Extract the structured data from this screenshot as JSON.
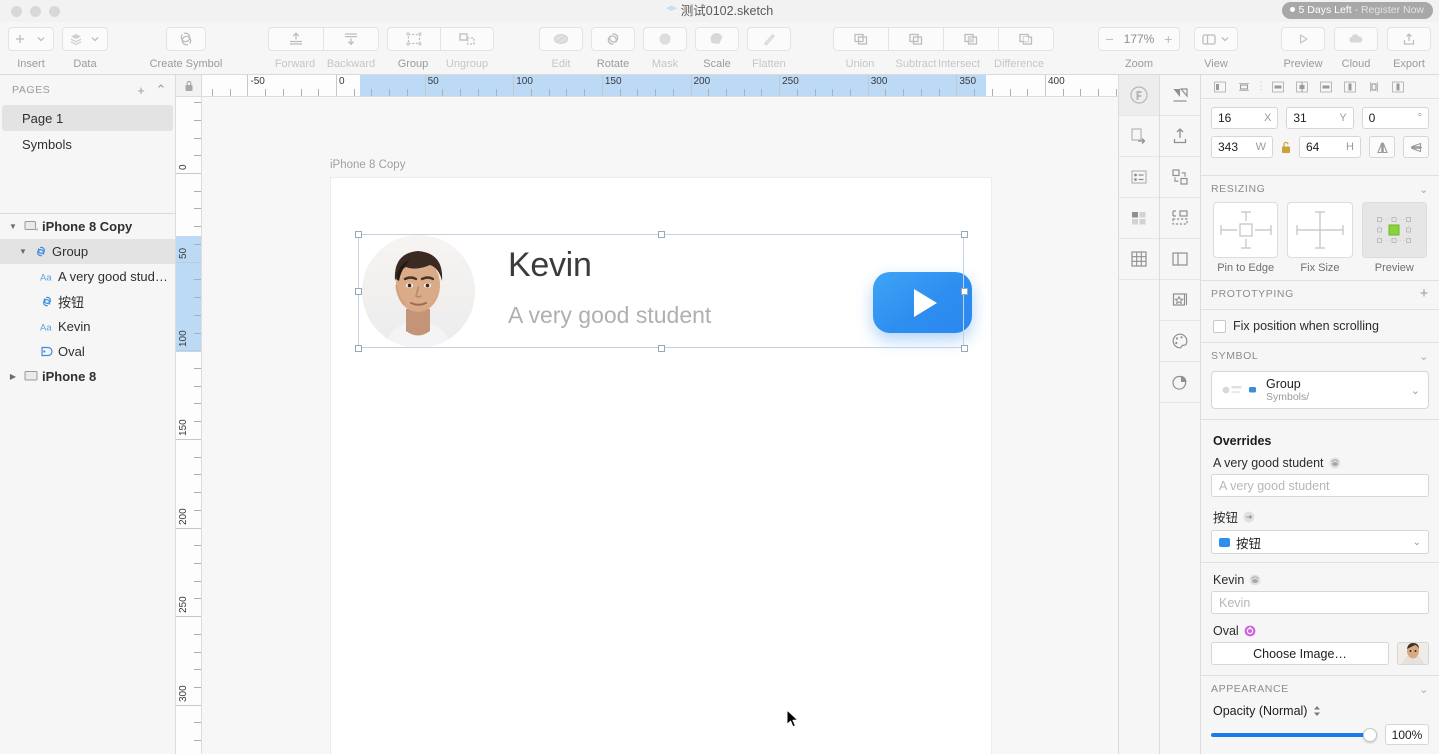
{
  "window": {
    "document_title": "测试0102.sketch",
    "license_days": "5 Days Left",
    "license_register": "- Register Now",
    "traffic_lights": [
      "close",
      "minimize",
      "zoom"
    ]
  },
  "toolbar": {
    "items": [
      {
        "label": "Insert",
        "icon": "plus-dropdown-icon",
        "disabled": false
      },
      {
        "label": "Data",
        "icon": "layers-dropdown-icon",
        "disabled": false
      },
      {
        "label": "Create Symbol",
        "icon": "create-symbol-icon",
        "disabled": false
      },
      {
        "label": "Forward",
        "icon": "bring-forward-icon",
        "disabled": true
      },
      {
        "label": "Backward",
        "icon": "send-backward-icon",
        "disabled": true
      },
      {
        "label": "Group",
        "icon": "group-icon",
        "disabled": false
      },
      {
        "label": "Ungroup",
        "icon": "ungroup-icon",
        "disabled": true
      },
      {
        "label": "Edit",
        "icon": "edit-icon",
        "disabled": true
      },
      {
        "label": "Rotate",
        "icon": "rotate-icon",
        "disabled": false
      },
      {
        "label": "Mask",
        "icon": "mask-icon",
        "disabled": true
      },
      {
        "label": "Scale",
        "icon": "scale-icon",
        "disabled": false
      },
      {
        "label": "Flatten",
        "icon": "flatten-icon",
        "disabled": true
      },
      {
        "label": "Union",
        "icon": "union-icon",
        "disabled": true
      },
      {
        "label": "Subtract",
        "icon": "subtract-icon",
        "disabled": true
      },
      {
        "label": "Intersect",
        "icon": "intersect-icon",
        "disabled": true
      },
      {
        "label": "Difference",
        "icon": "difference-icon",
        "disabled": true
      },
      {
        "label": "Preview",
        "icon": "preview-play-icon",
        "disabled": false
      },
      {
        "label": "Cloud",
        "icon": "cloud-icon",
        "disabled": false
      },
      {
        "label": "Export",
        "icon": "export-upload-icon",
        "disabled": false
      }
    ],
    "zoom": {
      "label": "Zoom",
      "value": "177%",
      "minus": "−",
      "plus": "+"
    },
    "view": {
      "label": "View",
      "icon": "layout-panels-icon"
    }
  },
  "pages": {
    "header": "PAGES",
    "add_label": "+",
    "collapse_label": "⌃",
    "items": [
      {
        "name": "Page 1",
        "selected": true
      },
      {
        "name": "Symbols",
        "selected": false
      }
    ]
  },
  "layers": [
    {
      "name": "iPhone 8 Copy",
      "icon": "artboard-icon",
      "depth": 0,
      "expanded": true,
      "selected": false
    },
    {
      "name": "Group",
      "icon": "symbol-icon",
      "depth": 1,
      "expanded": true,
      "selected": true
    },
    {
      "name": "A very good stud…",
      "icon": "text-icon",
      "depth": 2,
      "expanded": null,
      "selected": false
    },
    {
      "name": "按钮",
      "icon": "symbol-icon",
      "depth": 2,
      "expanded": null,
      "selected": false
    },
    {
      "name": "Kevin",
      "icon": "text-icon",
      "depth": 2,
      "expanded": null,
      "selected": false
    },
    {
      "name": "Oval",
      "icon": "image-shape-icon",
      "depth": 2,
      "expanded": null,
      "selected": false
    },
    {
      "name": "iPhone 8",
      "icon": "artboard-icon",
      "depth": 0,
      "expanded": false,
      "selected": false
    }
  ],
  "rulers": {
    "horizontal_labels": [
      "-50",
      "0",
      "50",
      "100",
      "150",
      "200",
      "250",
      "300",
      "350",
      "400"
    ],
    "vertical_labels": [
      "0",
      "50",
      "100",
      "150",
      "200",
      "250",
      "300"
    ],
    "h_selection": {
      "from": "0",
      "to": "353"
    },
    "v_selection": {
      "from": "31",
      "to": "95"
    }
  },
  "canvas": {
    "artboard_name": "iPhone 8 Copy",
    "widget": {
      "name": "Kevin",
      "subtitle": "A very good student",
      "button_icon": "play-triangle-icon",
      "avatar_alt": "portrait-photo"
    }
  },
  "plugin_rail_left": [
    {
      "icon": "framer-plugin-icon",
      "active": true
    },
    {
      "icon": "export-page-icon",
      "active": false
    },
    {
      "icon": "list-settings-icon",
      "active": false
    },
    {
      "icon": "swatch-grid-icon",
      "active": false
    },
    {
      "icon": "grid-table-icon",
      "active": false
    }
  ],
  "plugin_rail_right": [
    {
      "icon": "mirror-flip-icon"
    },
    {
      "icon": "upload-arrow-icon"
    },
    {
      "icon": "swap-shapes-icon"
    },
    {
      "icon": "distribute-icon"
    },
    {
      "icon": "split-panel-icon"
    },
    {
      "icon": "star-frame-icon"
    },
    {
      "icon": "palette-icon"
    },
    {
      "icon": "pie-chart-icon"
    }
  ],
  "inspector": {
    "align_buttons": [
      "align-left-icon",
      "align-center-horizontal-icon",
      "more-options-icon",
      "align-top-icon",
      "align-middle-vertical-icon",
      "align-bottom-icon",
      "distribute-left-icon",
      "distribute-center-icon",
      "distribute-right-icon"
    ],
    "geometry": {
      "x": {
        "value": "16",
        "unit": "X"
      },
      "y": {
        "value": "31",
        "unit": "Y"
      },
      "rotation": {
        "value": "0",
        "unit": "°"
      },
      "w": {
        "value": "343",
        "unit": "W"
      },
      "h": {
        "value": "64",
        "unit": "H"
      },
      "lock_icon": "unlocked-icon",
      "flip_h_icon": "flip-horizontal-icon",
      "flip_v_icon": "flip-vertical-icon"
    },
    "resizing": {
      "header": "RESIZING",
      "options": [
        {
          "label": "Pin to Edge",
          "selected": false
        },
        {
          "label": "Fix Size",
          "selected": false
        },
        {
          "label": "Preview",
          "selected": true
        }
      ]
    },
    "prototyping": {
      "header": "PROTOTYPING",
      "add_label": "+",
      "checkbox_label": "Fix position when scrolling",
      "checked": false
    },
    "symbol": {
      "header": "SYMBOL",
      "name": "Group",
      "path": "Symbols/",
      "overrides_title": "Overrides",
      "overrides": [
        {
          "label": "A very good student",
          "type": "text",
          "placeholder": "A very good student",
          "badge": "text-override-icon",
          "badge_color": "#b9b9b9"
        },
        {
          "label": "按钮",
          "type": "symbol",
          "value": "按钮",
          "badge": "symbol-link-icon",
          "badge_color": "#b9b9b9",
          "swatch": "#2e8ef0"
        },
        {
          "label": "Kevin",
          "type": "text",
          "placeholder": "Kevin",
          "badge": "text-override-icon",
          "badge_color": "#b9b9b9"
        },
        {
          "label": "Oval",
          "type": "image",
          "button_label": "Choose Image…",
          "badge": "image-override-icon",
          "badge_color": "#cc66dd"
        }
      ]
    },
    "appearance": {
      "header": "APPEARANCE",
      "opacity_label": "Opacity (Normal)",
      "opacity_value": "100%",
      "opacity_percent": 100,
      "accent_color": "#1a7ceb"
    }
  }
}
